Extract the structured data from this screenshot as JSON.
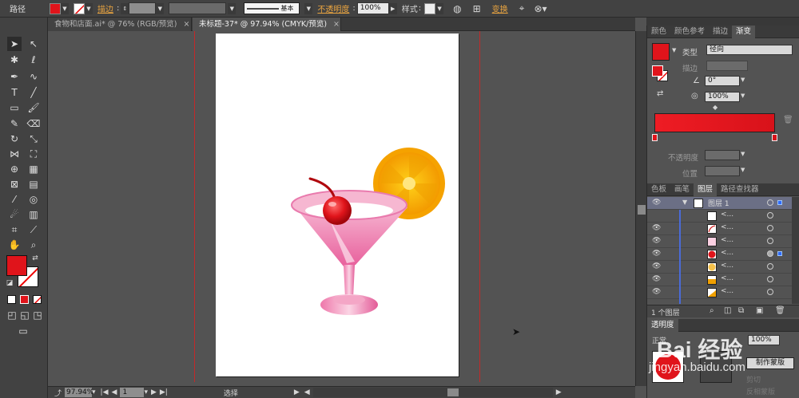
{
  "control_bar": {
    "object_type": "路径",
    "stroke_label": "描边",
    "stroke_style": "基本",
    "opacity_label": "不透明度",
    "opacity_value": "100%",
    "style_label": "样式",
    "transform_link": "变换",
    "fill_color": "#e0141b"
  },
  "tabs": [
    {
      "label": "食物和店面.ai* @ 76% (RGB/预览)"
    },
    {
      "label": "未标题-37* @ 97.94% (CMYK/预览)"
    }
  ],
  "status": {
    "zoom": "97.94%",
    "page": "1",
    "tool_status": "选择"
  },
  "gradient_panel": {
    "tabs": [
      "颜色",
      "颜色参考",
      "描边",
      "渐变"
    ],
    "type_label": "类型",
    "type_value": "径向",
    "stroke_label": "描边",
    "angle_value": "0°",
    "aspect_value": "100%",
    "opacity_label": "不透明度",
    "position_label": "位置",
    "color_start": "#ee1c24",
    "color_end": "#d8121a"
  },
  "layers_panel": {
    "tabs": [
      "色板",
      "画笔",
      "图层",
      "路径查找器"
    ],
    "layer_name": "图层 1",
    "sublayers": [
      {
        "name": "<...",
        "thumb": "white"
      },
      {
        "name": "<...",
        "thumb": "stem"
      },
      {
        "name": "<...",
        "thumb": "pink"
      },
      {
        "name": "<...",
        "thumb": "red-dot"
      },
      {
        "name": "<...",
        "thumb": "orange"
      },
      {
        "name": "<...",
        "thumb": "orange-half"
      },
      {
        "name": "<...",
        "thumb": "orange-slice"
      }
    ],
    "footer_count": "1 个图层"
  },
  "transparency_panel": {
    "title": "透明度",
    "mode_label": "正常",
    "opacity": "100%",
    "make_mask": "制作蒙版",
    "clip_label": "剪切",
    "invert_label": "反相蒙版"
  },
  "watermark": {
    "text": "Bai 经验",
    "url": "jingyan.baidu.com"
  }
}
